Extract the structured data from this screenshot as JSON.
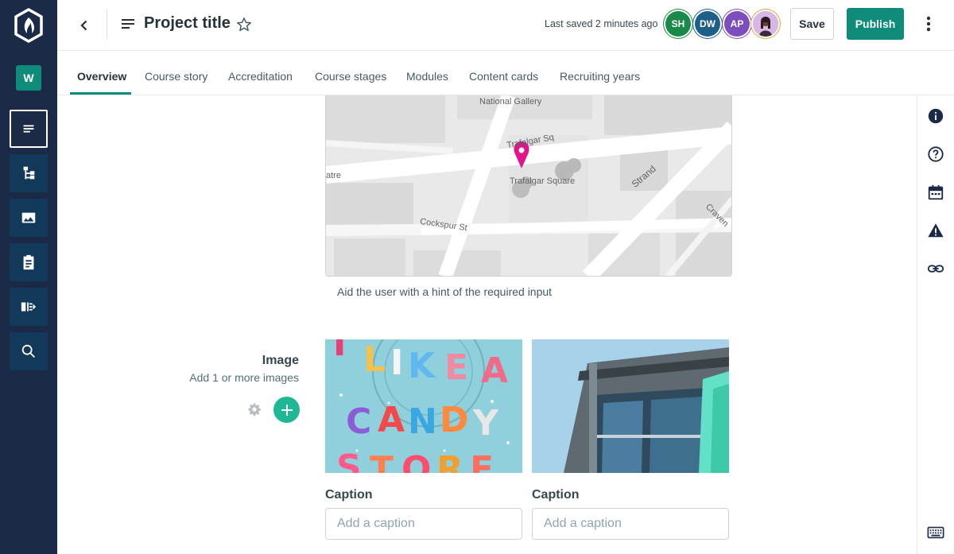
{
  "rail": {
    "workspace_initial": "W",
    "items": [
      {
        "icon": "document-lines-icon",
        "active": true
      },
      {
        "icon": "hierarchy-icon",
        "active": false
      },
      {
        "icon": "image-icon",
        "active": false
      },
      {
        "icon": "clipboard-icon",
        "active": false
      },
      {
        "icon": "panel-expand-icon",
        "active": false
      },
      {
        "icon": "search-icon",
        "active": false
      }
    ]
  },
  "header": {
    "title": "Project title",
    "last_saved": "Last saved 2 minutes ago",
    "avatars": [
      "SH",
      "DW",
      "AP"
    ],
    "save_label": "Save",
    "publish_label": "Publish"
  },
  "tabs": [
    {
      "label": "Overview",
      "active": true
    },
    {
      "label": "Course story",
      "active": false
    },
    {
      "label": "Accreditation",
      "active": false
    },
    {
      "label": "Course stages",
      "active": false
    },
    {
      "label": "Modules",
      "active": false
    },
    {
      "label": "Content cards",
      "active": false
    },
    {
      "label": "Recruiting years",
      "active": false
    }
  ],
  "map": {
    "labels": [
      "National Gallery",
      "Trafalgar Sq",
      "Trafalgar Square",
      "Strand",
      "Cockspur St",
      "atre",
      "Craven"
    ],
    "hint": "Aid the user with a hint of the required input"
  },
  "image_field": {
    "label": "Image",
    "sublabel": "Add 1 or more images",
    "images": [
      {
        "caption_label": "Caption",
        "caption_placeholder": "Add a caption"
      },
      {
        "caption_label": "Caption",
        "caption_placeholder": "Add a caption"
      }
    ]
  },
  "right_toolbar": [
    "info-icon",
    "help-icon",
    "calendar-icon",
    "warning-icon",
    "link-icon",
    "keyboard-icon"
  ],
  "colors": {
    "rail_bg": "#1b2a47",
    "accent": "#0f8b7a",
    "add_button": "#1fb796",
    "map_pin": "#e0158a"
  }
}
